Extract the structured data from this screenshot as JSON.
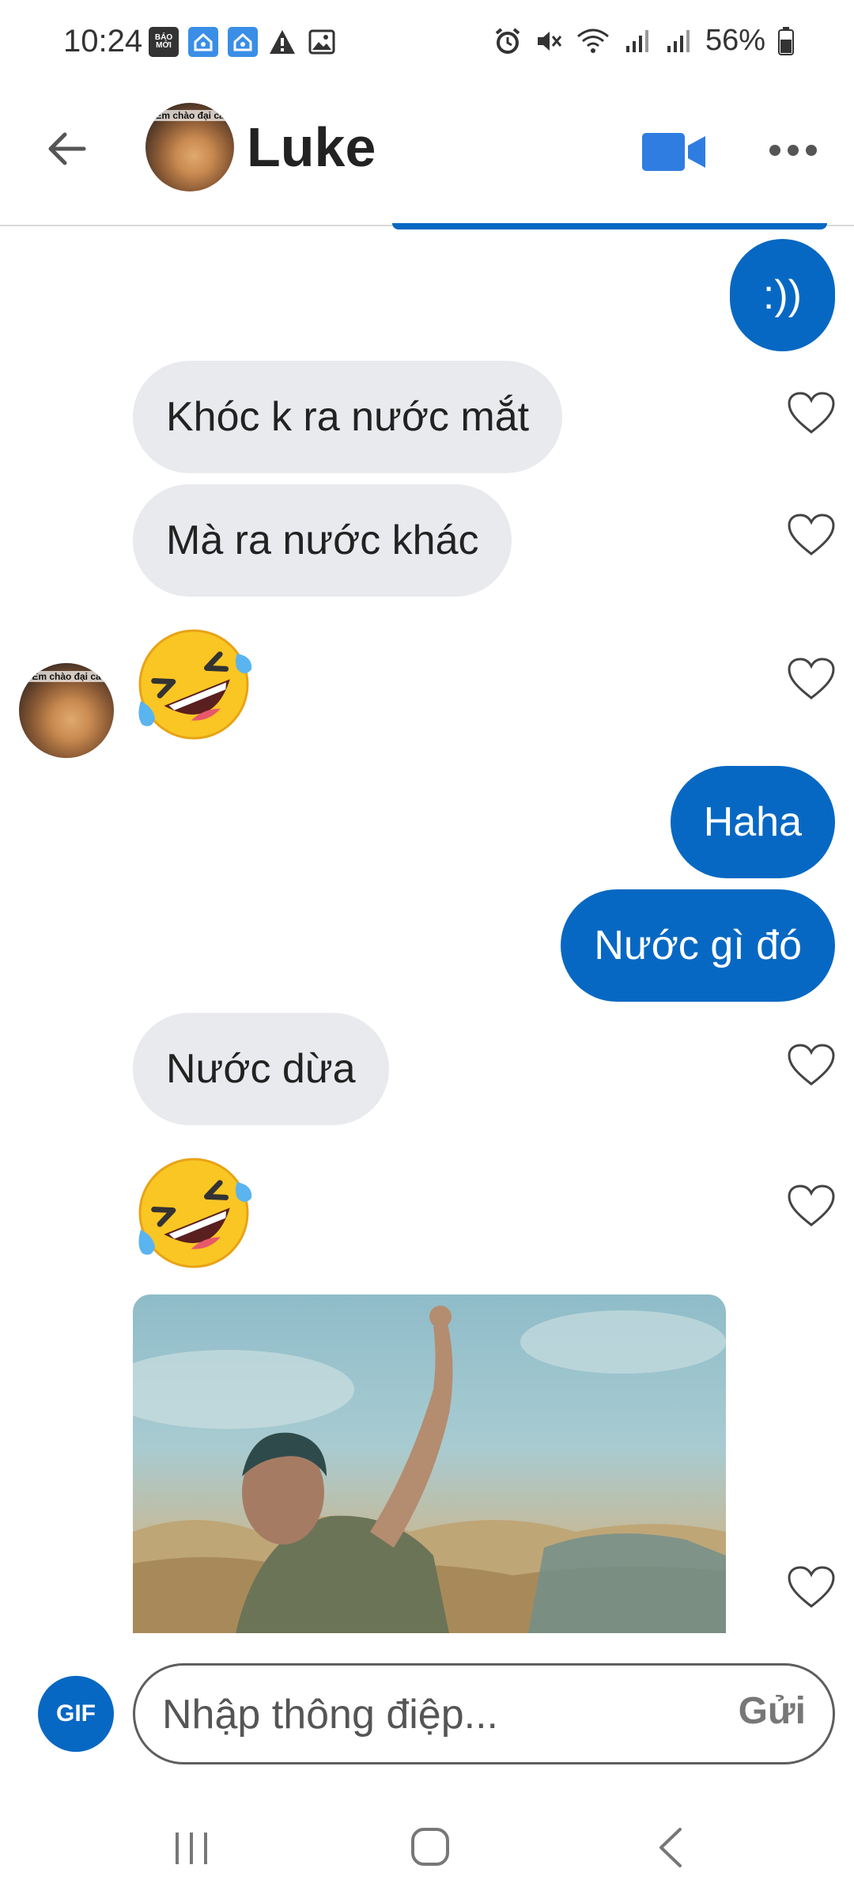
{
  "status_bar": {
    "time": "10:24",
    "battery_percent": "56%",
    "app_icons": [
      "bao-moi-icon",
      "home-app-icon",
      "home-app-icon",
      "warning-icon",
      "gallery-icon"
    ],
    "bao_moi_label": "BÁO MỚI"
  },
  "header": {
    "contact_name": "Luke",
    "avatar_caption": "Em chào đại ca"
  },
  "messages": [
    {
      "direction": "outgoing",
      "text": ":))"
    },
    {
      "direction": "incoming",
      "text": "Khóc k ra nước mắt"
    },
    {
      "direction": "incoming",
      "text": "Mà ra nước khác"
    },
    {
      "direction": "incoming",
      "emoji": "rolling-on-floor-laughing"
    },
    {
      "direction": "outgoing",
      "text": "Haha"
    },
    {
      "direction": "outgoing",
      "text": "Nước gì đó"
    },
    {
      "direction": "incoming",
      "text": "Nước dừa"
    },
    {
      "direction": "incoming",
      "emoji": "rolling-on-floor-laughing"
    },
    {
      "direction": "incoming",
      "gif": "dancing-woman-gif"
    }
  ],
  "composer": {
    "gif_label": "GIF",
    "placeholder": "Nhập thông điệp...",
    "send_label": "Gửi"
  },
  "colors": {
    "accent": "#0768c3",
    "incoming_bubble": "#e9eaee",
    "video_icon": "#2f7de1"
  }
}
